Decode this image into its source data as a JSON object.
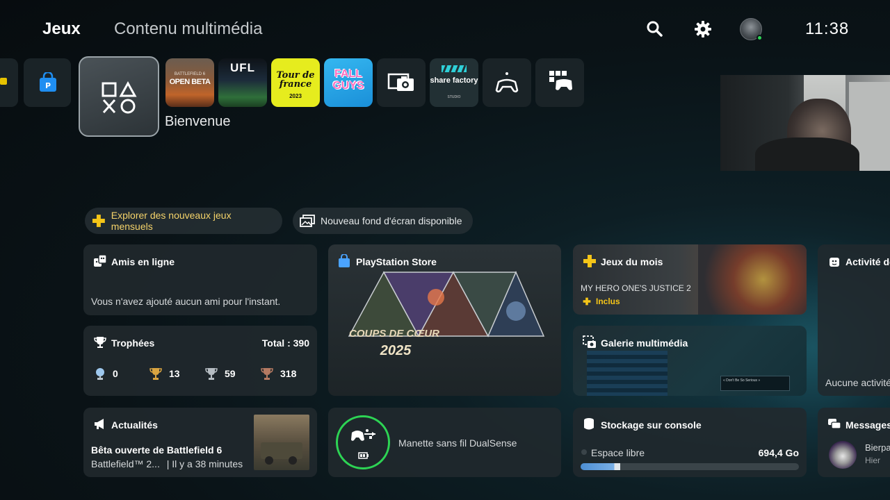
{
  "nav": {
    "tab_games": "Jeux",
    "tab_media": "Contenu multimédia",
    "clock": "11:38"
  },
  "games_row": {
    "welcome_label": "Bienvenue",
    "tiles": [
      {
        "name": "Battlefield 6 Open Beta",
        "text_top": "BATTLEFIELD 6",
        "text_main": "OPEN BETA"
      },
      {
        "name": "UFL",
        "text_main": "UFL"
      },
      {
        "name": "Tour de France 2023",
        "text_main": "Tour de france",
        "text_sub": "2023"
      },
      {
        "name": "Fall Guys",
        "text_main": "FALL GUYS"
      },
      {
        "name": "Capture gallery",
        "icon": "camera-gallery-icon"
      },
      {
        "name": "Share Factory Studio",
        "text_main": "share factory",
        "text_sub": "STUDIO"
      },
      {
        "name": "Remote play",
        "icon": "remote-play-icon"
      },
      {
        "name": "Game library",
        "icon": "game-library-icon"
      }
    ]
  },
  "chips": {
    "monthly_games": "Explorer des nouveaux jeux mensuels",
    "wallpaper": "Nouveau fond d'écran disponible"
  },
  "friends": {
    "title": "Amis en ligne",
    "message": "Vous n'avez ajouté aucun ami pour l'instant."
  },
  "trophies": {
    "title": "Trophées",
    "total": "Total : 390",
    "platinum": "0",
    "gold": "13",
    "silver": "59",
    "bronze": "318"
  },
  "store": {
    "title": "PlayStation Store",
    "banner_line1": "COUPS DE CŒUR",
    "banner_line2": "2025"
  },
  "monthly": {
    "title": "Jeux du mois",
    "game": "MY HERO ONE'S JUSTICE 2",
    "badge": "Inclus"
  },
  "gallery": {
    "title": "Galerie multimédia",
    "preview_text": "« Don't Be So Serious »"
  },
  "activity": {
    "title": "Activité de",
    "message": "Aucune activité"
  },
  "news": {
    "title": "Actualités",
    "headline": "Bêta ouverte de Battlefield 6",
    "source": "Battlefield™ 2...",
    "time": "| Il y a 38 minutes"
  },
  "controller": {
    "label": "Manette sans fil DualSense"
  },
  "storage": {
    "title": "Stockage sur console",
    "free_label": "Espace libre",
    "free_value": "694,4 Go",
    "used_fraction": 0.18
  },
  "messages": {
    "title": "Messages",
    "sender": "Bierpa",
    "time": "Hier"
  },
  "colors": {
    "accent_yellow": "#f5c518",
    "accent_green": "#2dd454",
    "storage_bar": "#4d8fd4"
  }
}
